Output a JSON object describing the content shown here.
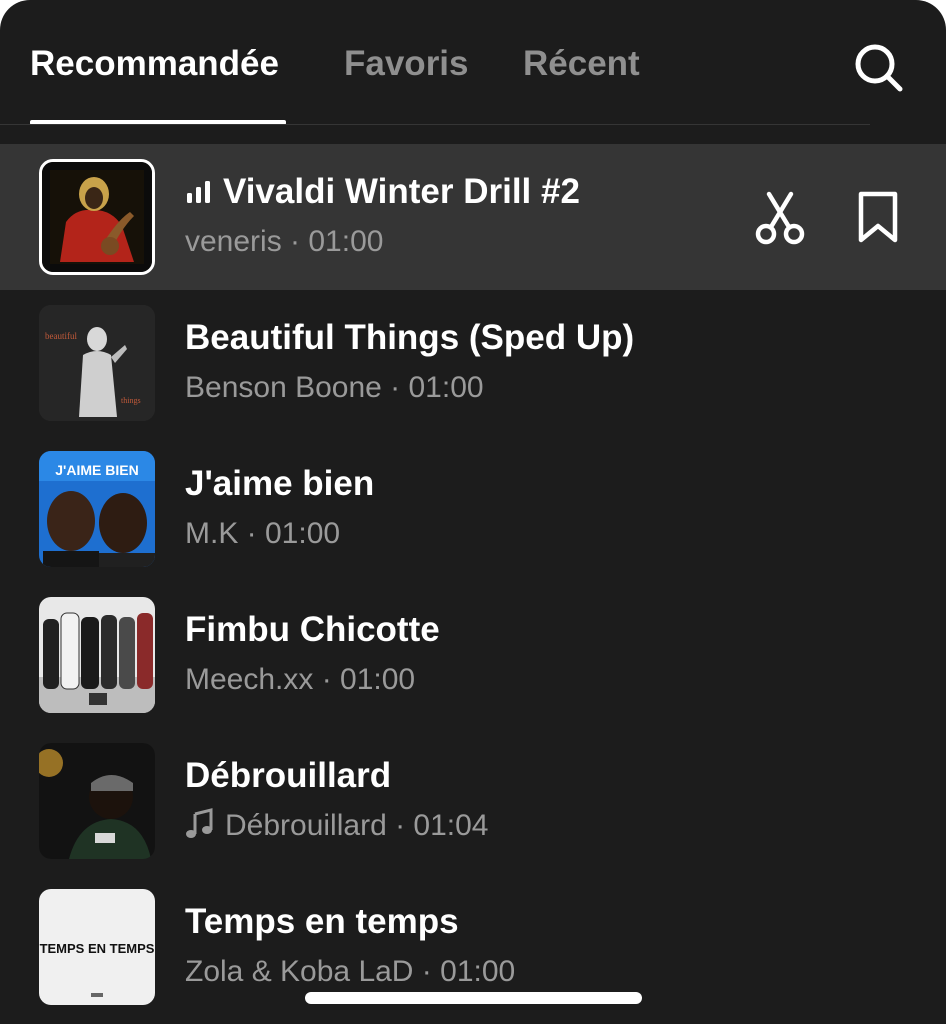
{
  "tabs": [
    {
      "label": "Recommandée",
      "active": true
    },
    {
      "label": "Favoris",
      "active": false
    },
    {
      "label": "Récent",
      "active": false
    }
  ],
  "search_icon": "search-icon",
  "tracks": [
    {
      "title": "Vivaldi Winter Drill #2",
      "subtitle": "veneris · 01:00",
      "selected": true,
      "playing": true,
      "actions": [
        "scissors-icon",
        "bookmark-icon"
      ]
    },
    {
      "title": "Beautiful Things (Sped Up)",
      "subtitle": "Benson Boone · 01:00"
    },
    {
      "title": "J'aime bien",
      "subtitle": "M.K · 01:00",
      "cover_text": "J'AIME BIEN"
    },
    {
      "title": "Fimbu Chicotte",
      "subtitle": "Meech.xx · 01:00"
    },
    {
      "title": "Débrouillard",
      "subtitle": "Débrouillard · 01:04",
      "subtitle_icon": "music-note-icon"
    },
    {
      "title": "Temps en temps",
      "subtitle": "Zola & Koba LaD · 01:00",
      "cover_text": "TEMPS EN TEMPS"
    }
  ],
  "colors": {
    "background": "#1c1c1c",
    "selected_row": "#353535",
    "active_text": "#ffffff",
    "inactive_text": "#8f8f8f",
    "secondary_text": "#9a9a9a"
  }
}
